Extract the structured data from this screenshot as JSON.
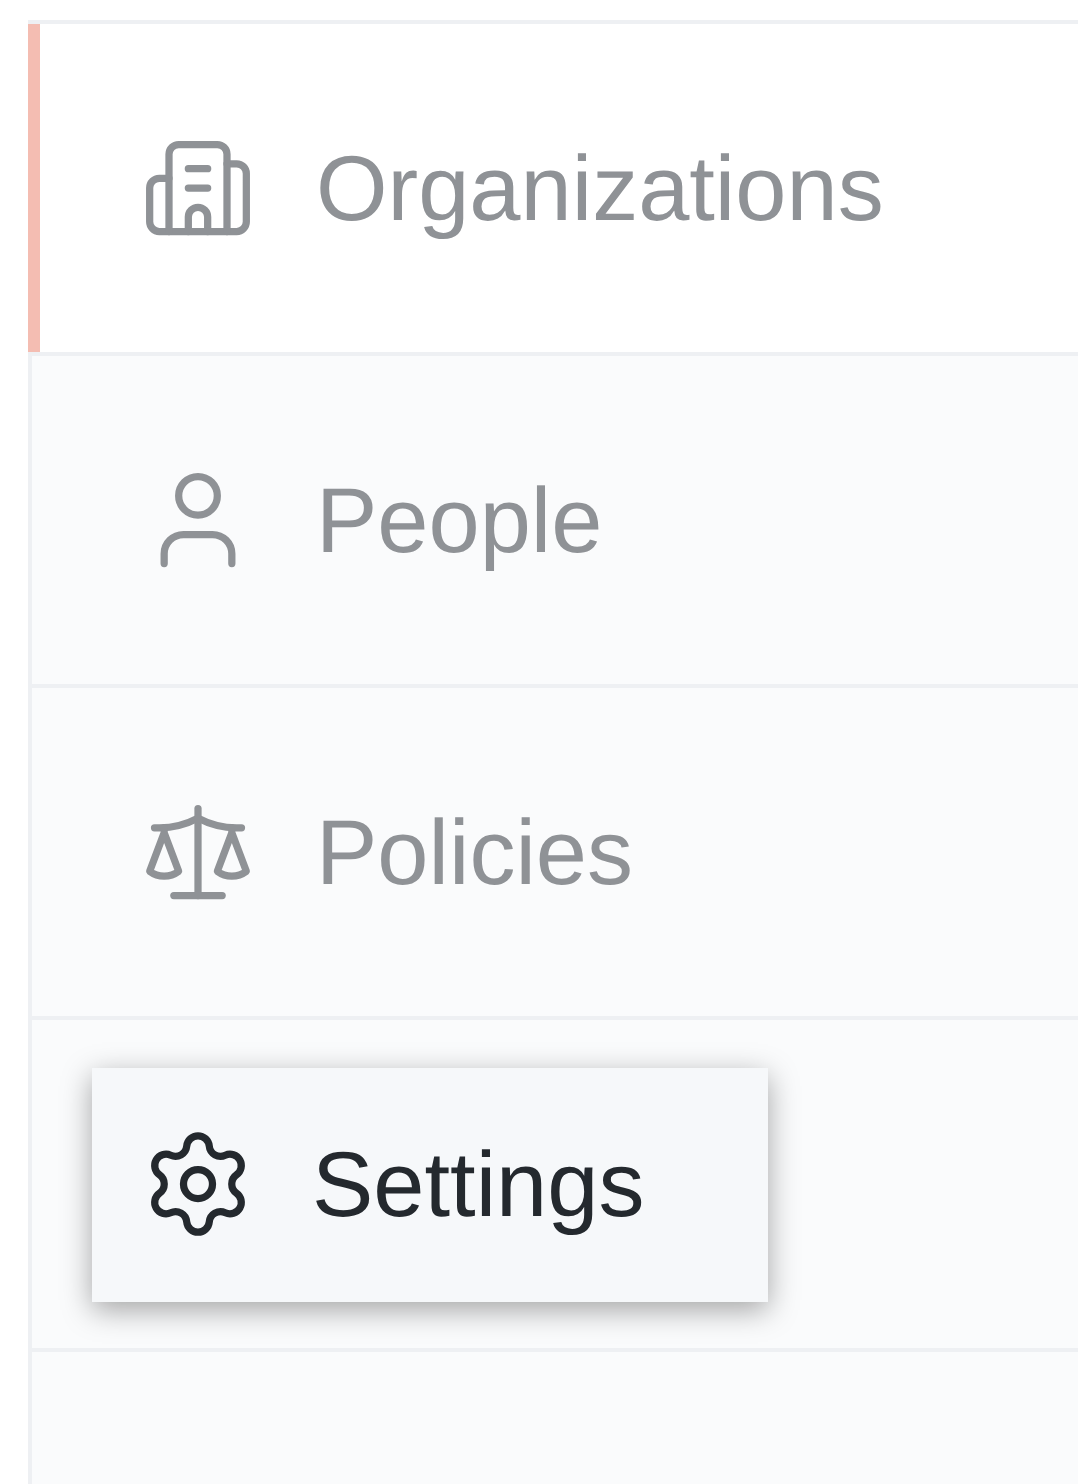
{
  "sidebar": {
    "items": [
      {
        "label": "Organizations",
        "kind": "building",
        "selected": true,
        "highlighted": false
      },
      {
        "label": "People",
        "kind": "person",
        "selected": false,
        "highlighted": false
      },
      {
        "label": "Policies",
        "kind": "scale",
        "selected": false,
        "highlighted": false
      },
      {
        "label": "Settings",
        "kind": "gear",
        "selected": false,
        "highlighted": true
      }
    ]
  }
}
